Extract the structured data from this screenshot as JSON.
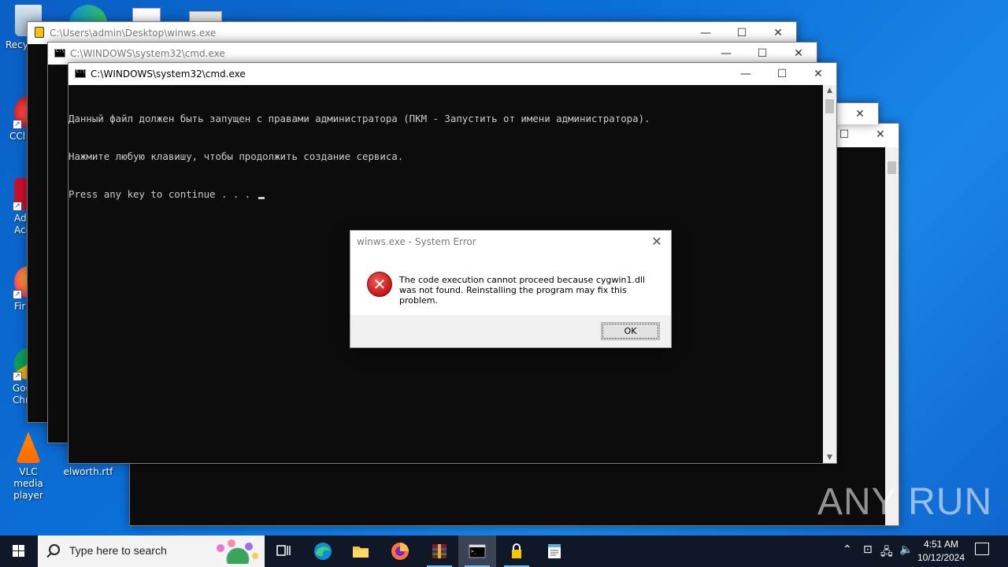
{
  "desktop": {
    "icons": [
      {
        "label": "Recy"
      },
      {
        "label": "CCl"
      },
      {
        "label": "Ad Acr"
      },
      {
        "label": "Fir"
      },
      {
        "label": "Goo Chr"
      },
      {
        "label": "VLC media player"
      },
      {
        "label": "elworth.rtf"
      }
    ]
  },
  "windows": {
    "winws": {
      "title": "C:\\Users\\admin\\Desktop\\winws.exe"
    },
    "cmd_back": {
      "title": "C:\\WINDOWS\\system32\\cmd.exe"
    },
    "cmd_front": {
      "title": "C:\\WINDOWS\\system32\\cmd.exe",
      "lines": [
        "Данный файл должен быть запущен с правами администратора (ПКМ - Запустить от имени администратора).",
        "Нажмите любую клавишу, чтобы продолжить создание сервиса.",
        "Press any key to continue . . . "
      ]
    },
    "controls": {
      "minimize": "—",
      "maximize": "☐",
      "close": "✕"
    }
  },
  "dialog": {
    "title": "winws.exe - System Error",
    "message": "The code execution cannot proceed because cygwin1.dll was not found. Reinstalling the program may fix this problem.",
    "ok_label": "OK",
    "close": "✕"
  },
  "taskbar": {
    "search_placeholder": "Type here to search",
    "time": "4:51 AM",
    "date": "10/12/2024",
    "apps": [
      "task-view",
      "edge",
      "file-explorer",
      "firefox",
      "winrar",
      "cmd",
      "lock-app",
      "notepad"
    ]
  },
  "watermark": "ANY RUN",
  "colors": {
    "desktop": "#0b6fd8",
    "console_bg": "#0c0c0c",
    "console_fg": "#cccccc",
    "taskbar": "#101828"
  }
}
